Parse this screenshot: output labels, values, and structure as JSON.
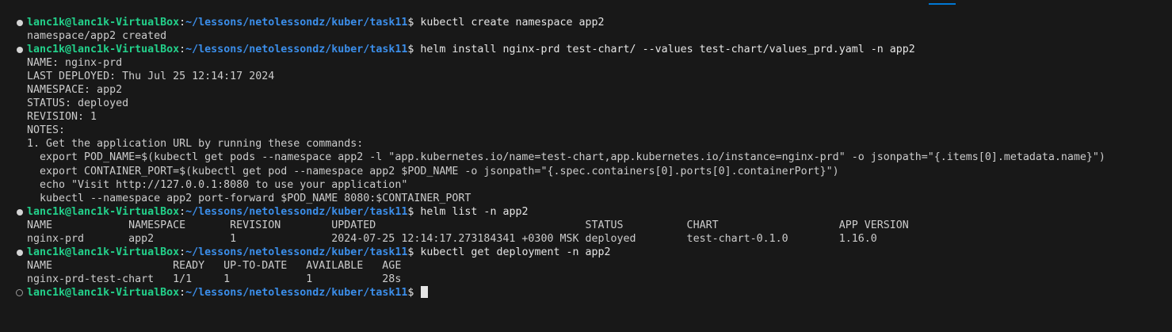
{
  "prompt": {
    "user": "lanc1k@lanc1k-VirtualBox",
    "separator": ":",
    "path": "~/lessons/netolessondz/kuber/task11",
    "sign": "$"
  },
  "lines": [
    {
      "type": "prompt",
      "decoration": "done",
      "command": " kubectl create namespace app2"
    },
    {
      "type": "output",
      "text": "namespace/app2 created"
    },
    {
      "type": "prompt",
      "decoration": "done",
      "command": " helm install nginx-prd test-chart/ --values test-chart/values_prd.yaml -n app2"
    },
    {
      "type": "output",
      "text": "NAME: nginx-prd"
    },
    {
      "type": "output",
      "text": "LAST DEPLOYED: Thu Jul 25 12:14:17 2024"
    },
    {
      "type": "output",
      "text": "NAMESPACE: app2"
    },
    {
      "type": "output",
      "text": "STATUS: deployed"
    },
    {
      "type": "output",
      "text": "REVISION: 1"
    },
    {
      "type": "output",
      "text": "NOTES:"
    },
    {
      "type": "output",
      "text": "1. Get the application URL by running these commands:"
    },
    {
      "type": "output",
      "text": "  export POD_NAME=$(kubectl get pods --namespace app2 -l \"app.kubernetes.io/name=test-chart,app.kubernetes.io/instance=nginx-prd\" -o jsonpath=\"{.items[0].metadata.name}\")"
    },
    {
      "type": "output",
      "text": "  export CONTAINER_PORT=$(kubectl get pod --namespace app2 $POD_NAME -o jsonpath=\"{.spec.containers[0].ports[0].containerPort}\")"
    },
    {
      "type": "output",
      "text": "  echo \"Visit http://127.0.0.1:8080 to use your application\""
    },
    {
      "type": "output",
      "text": "  kubectl --namespace app2 port-forward $POD_NAME 8080:$CONTAINER_PORT"
    },
    {
      "type": "prompt",
      "decoration": "done",
      "command": " helm list -n app2"
    },
    {
      "type": "output",
      "text": "NAME     \tNAMESPACE\tREVISION\tUPDATED                                \tSTATUS  \tCHART           \tAPP VERSION"
    },
    {
      "type": "output",
      "text": "nginx-prd\tapp2     \t1       \t2024-07-25 12:14:17.273184341 +0300 MSK\tdeployed\ttest-chart-0.1.0\t1.16.0     "
    },
    {
      "type": "prompt",
      "decoration": "done",
      "command": " kubectl get deployment -n app2"
    },
    {
      "type": "output",
      "text": "NAME                   READY   UP-TO-DATE   AVAILABLE   AGE"
    },
    {
      "type": "output",
      "text": "nginx-prd-test-chart   1/1     1            1           28s"
    },
    {
      "type": "prompt",
      "decoration": "empty",
      "command": " ",
      "cursor": true
    }
  ]
}
